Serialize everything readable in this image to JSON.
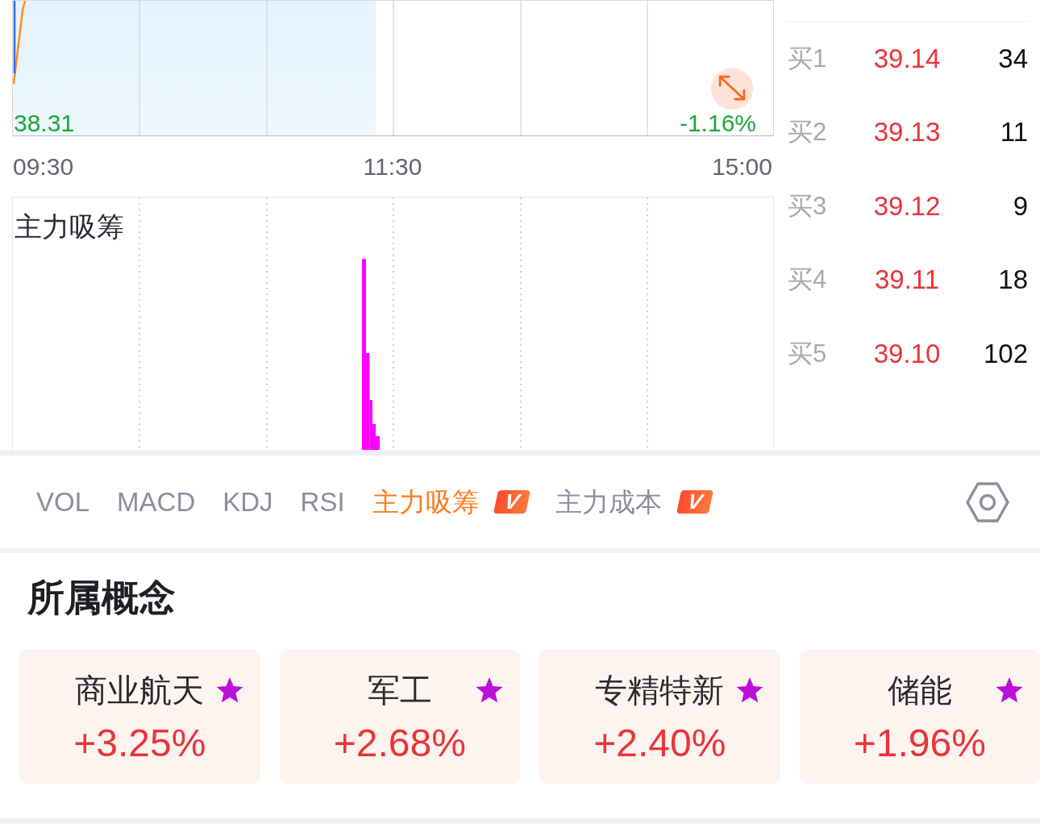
{
  "price_chart": {
    "bottom_price": "38.31",
    "bottom_change": "-1.16%"
  },
  "time_axis": [
    "09:30",
    "11:30",
    "15:00"
  ],
  "flow_chart": {
    "title": "主力吸筹"
  },
  "order_book": {
    "bids": [
      {
        "label": "买1",
        "price": "39.14",
        "volume": "34"
      },
      {
        "label": "买2",
        "price": "39.13",
        "volume": "11"
      },
      {
        "label": "买3",
        "price": "39.12",
        "volume": "9"
      },
      {
        "label": "买4",
        "price": "39.11",
        "volume": "18"
      },
      {
        "label": "买5",
        "price": "39.10",
        "volume": "102"
      }
    ]
  },
  "indicator_tabs": [
    {
      "label": "VOL",
      "selected": false
    },
    {
      "label": "MACD",
      "selected": false
    },
    {
      "label": "KDJ",
      "selected": false
    },
    {
      "label": "RSI",
      "selected": false
    },
    {
      "label": "主力吸筹",
      "selected": true,
      "badge": "V"
    },
    {
      "label": "主力成本",
      "selected": false,
      "badge": "V"
    }
  ],
  "concepts": {
    "title": "所属概念",
    "items": [
      {
        "name": "商业航天",
        "change": "+3.25%"
      },
      {
        "name": "军工",
        "change": "+2.68%"
      },
      {
        "name": "专精特新",
        "change": "+2.40%"
      },
      {
        "name": "储能",
        "change": "+1.96%"
      }
    ]
  }
}
